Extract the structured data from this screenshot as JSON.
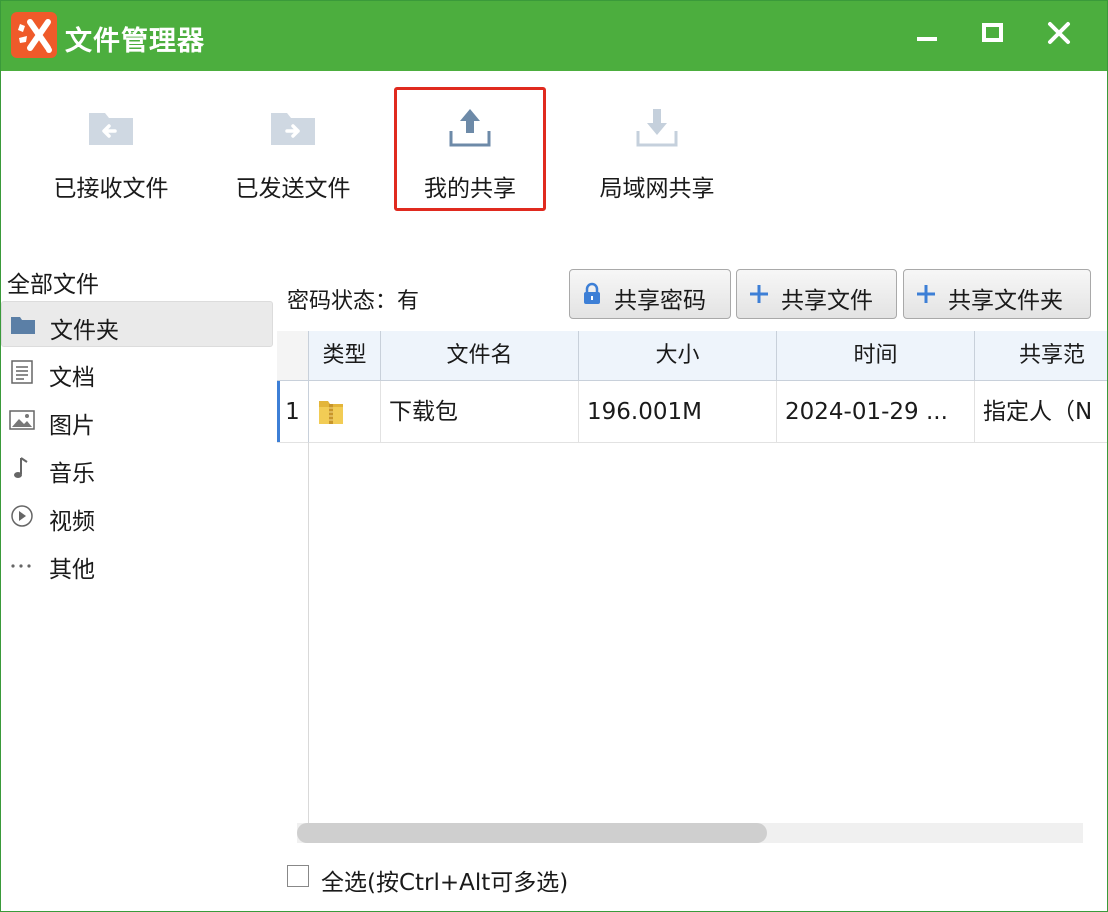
{
  "window": {
    "title": "文件管理器",
    "accent_color": "#4cae3e",
    "logo_color": "#ef5a2a",
    "icons": {
      "logo": "app-logo-icon",
      "minimize": "minimize-icon",
      "maximize": "maximize-icon",
      "close": "close-icon"
    }
  },
  "toolbar": {
    "items": [
      {
        "label": "已接收文件",
        "icon": "folder-left-arrow-icon"
      },
      {
        "label": "已发送文件",
        "icon": "folder-right-arrow-icon"
      },
      {
        "label": "我的共享",
        "icon": "upload-icon",
        "highlighted": true
      },
      {
        "label": "局域网共享",
        "icon": "download-icon"
      }
    ]
  },
  "sidebar": {
    "title": "全部文件",
    "items": [
      {
        "label": "文件夹",
        "icon": "folder-icon",
        "active": true
      },
      {
        "label": "文档",
        "icon": "document-icon"
      },
      {
        "label": "图片",
        "icon": "image-icon"
      },
      {
        "label": "音乐",
        "icon": "music-note-icon"
      },
      {
        "label": "视频",
        "icon": "play-circle-icon"
      },
      {
        "label": "其他",
        "icon": "more-dots-icon"
      }
    ]
  },
  "actions": {
    "password_status": "密码状态：有",
    "buttons": [
      {
        "label": "共享密码",
        "icon": "lock-icon"
      },
      {
        "label": "共享文件",
        "icon": "plus-icon"
      },
      {
        "label": "共享文件夹",
        "icon": "plus-icon"
      }
    ]
  },
  "table": {
    "columns": [
      "类型",
      "文件名",
      "大小",
      "时间",
      "共享范"
    ],
    "rows": [
      {
        "index": "1",
        "type_icon": "folder-zip-icon",
        "name": "下载包",
        "size": "196.001M",
        "time": "2024-01-29 ...",
        "scope": "指定人（N"
      }
    ]
  },
  "footer": {
    "select_all_label": "全选(按Ctrl+Alt可多选)",
    "select_all_checked": false
  }
}
